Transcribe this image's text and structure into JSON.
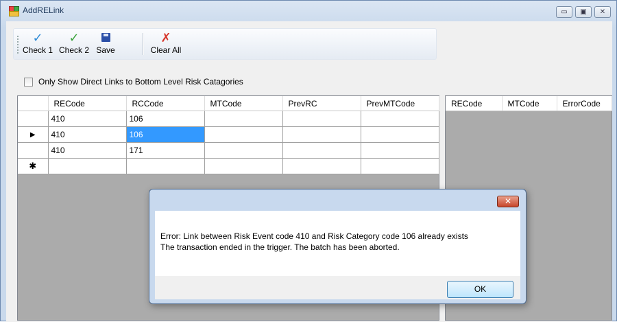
{
  "window": {
    "title": "AddRELink",
    "buttons": [
      "▭",
      "▣",
      "✕"
    ]
  },
  "toolbar": {
    "check1": "Check 1",
    "check2": "Check 2",
    "save": "Save",
    "clear_all": "Clear All"
  },
  "filter": {
    "checkbox_label": "Only Show Direct Links to Bottom Level Risk Catagories",
    "checked": false
  },
  "left_grid": {
    "columns": [
      "RECode",
      "RCCode",
      "MTCode",
      "PrevRC",
      "PrevMTCode"
    ],
    "rows": [
      {
        "indicator": "",
        "cells": [
          "410",
          "106",
          "",
          "",
          ""
        ]
      },
      {
        "indicator": "▶",
        "cells": [
          "410",
          "106",
          "",
          "",
          ""
        ]
      },
      {
        "indicator": "",
        "cells": [
          "410",
          "171",
          "",
          "",
          ""
        ]
      },
      {
        "indicator": "✱",
        "cells": [
          "",
          "",
          "",
          "",
          ""
        ]
      }
    ],
    "selected": {
      "row": 1,
      "col": 1
    }
  },
  "right_grid": {
    "columns": [
      "RECode",
      "MTCode",
      "ErrorCode"
    ]
  },
  "dialog": {
    "line1": "Error: Link between Risk Event code 410 and Risk Category code 106 already exists",
    "line2": "The transaction ended in the trigger. The batch has been aborted.",
    "ok": "OK",
    "close": "✕"
  },
  "colors": {
    "selection": "#3399ff",
    "check_icon": "#2e8bd6",
    "check2_icon": "#3aa33a",
    "clear_icon": "#d6362b"
  }
}
